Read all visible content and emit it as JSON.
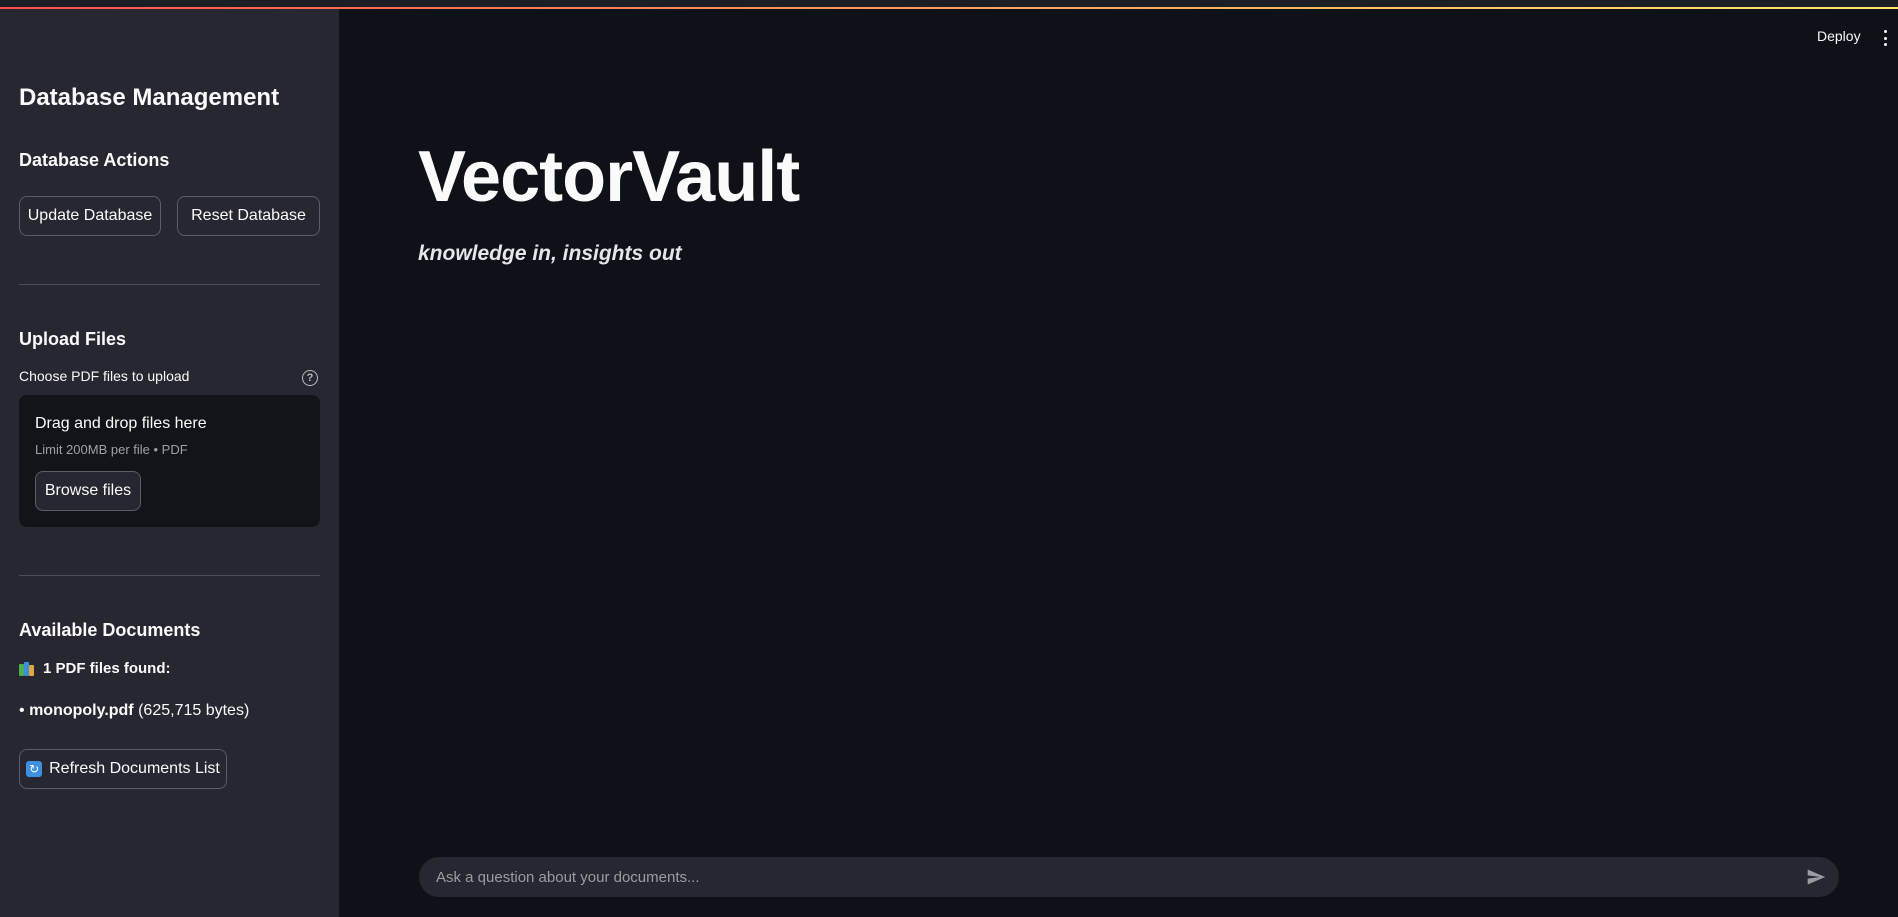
{
  "header": {
    "deploy_label": "Deploy",
    "menu_icon": "kebab-menu-icon"
  },
  "sidebar": {
    "title": "Database Management",
    "actions": {
      "heading": "Database Actions",
      "update_label": "Update Database",
      "reset_label": "Reset Database"
    },
    "upload": {
      "heading": "Upload Files",
      "label": "Choose PDF files to upload",
      "dropzone_title": "Drag and drop files here",
      "dropzone_limit": "Limit 200MB per file • PDF",
      "browse_label": "Browse files"
    },
    "documents": {
      "heading": "Available Documents",
      "count_text": "1 PDF files found:",
      "items": [
        {
          "bullet": "•",
          "name": "monopoly.pdf",
          "size": "(625,715 bytes)"
        }
      ],
      "refresh_label": "Refresh Documents List"
    }
  },
  "main": {
    "title": "VectorVault",
    "subtitle": "knowledge in, insights out",
    "chat": {
      "placeholder": "Ask a question about your documents...",
      "value": ""
    }
  },
  "colors": {
    "background": "#0e1117",
    "sidebar": "#262730",
    "accent_gradient_start": "#ff4b4b",
    "accent_gradient_end": "#ffe86b",
    "refresh_icon": "#3d8fe0"
  }
}
